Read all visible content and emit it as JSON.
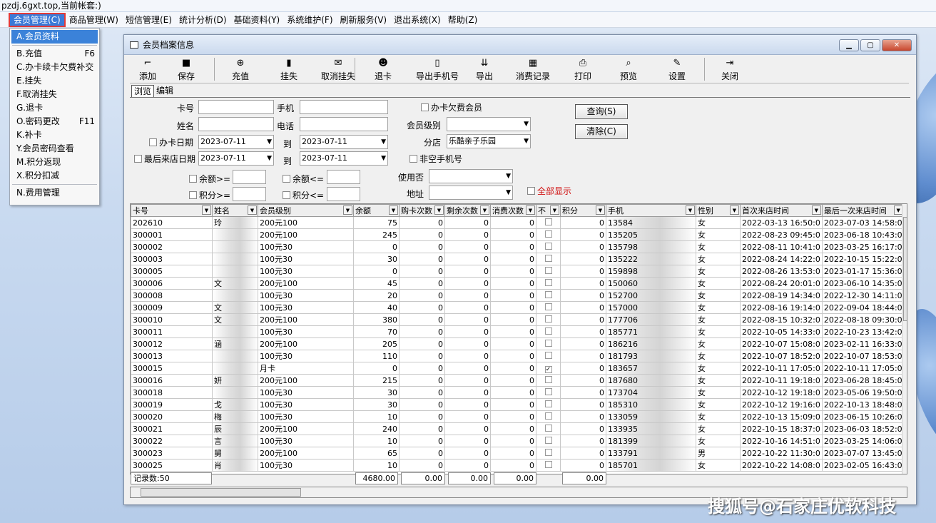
{
  "top_title": "pzdj.6gxt.top,当前帐套:)",
  "menubar": [
    "会员管理(C)",
    "商品管理(W)",
    "短信管理(E)",
    "统计分析(D)",
    "基础资料(Y)",
    "系统维护(F)",
    "刷新服务(V)",
    "退出系统(X)",
    "帮助(Z)"
  ],
  "dropdown": [
    {
      "label": "A.会员资料",
      "key": ""
    },
    {
      "sep": true
    },
    {
      "label": "B.充值",
      "key": "F6"
    },
    {
      "label": "C.办卡续卡欠费补交",
      "key": ""
    },
    {
      "label": "E.挂失",
      "key": ""
    },
    {
      "label": "F.取消挂失",
      "key": ""
    },
    {
      "label": "G.退卡",
      "key": ""
    },
    {
      "label": "O.密码更改",
      "key": "F11"
    },
    {
      "label": "K.补卡",
      "key": ""
    },
    {
      "label": "Y.会员密码查看",
      "key": ""
    },
    {
      "label": "M.积分返现",
      "key": ""
    },
    {
      "label": "X.积分扣减",
      "key": ""
    },
    {
      "sep": true
    },
    {
      "label": "N.费用管理",
      "key": ""
    }
  ],
  "window_title": "会员档案信息",
  "toolbar": [
    {
      "label": "添加",
      "icon": "add-icon"
    },
    {
      "label": "保存",
      "icon": "save-icon"
    },
    {
      "label": "充值",
      "icon": "recharge-icon"
    },
    {
      "label": "挂失",
      "icon": "report-loss-icon"
    },
    {
      "label": "取消挂失",
      "icon": "cancel-loss-icon"
    },
    {
      "label": "退卡",
      "icon": "return-card-icon"
    },
    {
      "label": "导出手机号",
      "icon": "export-phone-icon"
    },
    {
      "label": "导出",
      "icon": "export-icon"
    },
    {
      "label": "消费记录",
      "icon": "consume-record-icon"
    },
    {
      "label": "打印",
      "icon": "print-icon"
    },
    {
      "label": "预览",
      "icon": "preview-icon"
    },
    {
      "label": "设置",
      "icon": "settings-icon"
    },
    {
      "label": "关闭",
      "icon": "close-door-icon"
    }
  ],
  "tabs": [
    "浏览",
    "编辑"
  ],
  "form": {
    "card_no": "卡号",
    "phone": "手机",
    "name": "姓名",
    "tel": "电话",
    "owe": "办卡欠费会员",
    "level": "会员级别",
    "card_date": "办卡日期",
    "date1": "2023-07-11",
    "to": "到",
    "date2": "2023-07-11",
    "branch": "分店",
    "branch_value": "乐酷亲子乐园",
    "last_visit": "最后来店日期",
    "date3": "2023-07-11",
    "date4": "2023-07-11",
    "non_empty_phone": "非空手机号",
    "balance_ge": "余额>=",
    "balance_le": "余额<=",
    "in_use": "使用否",
    "points_ge": "积分>=",
    "points_le": "积分<=",
    "address": "地址",
    "show_all": "全部显示",
    "query": "查询(S)",
    "clear": "清除(C)"
  },
  "columns": [
    "卡号",
    "姓名",
    "会员级别",
    "余额",
    "购卡次数",
    "剩余次数",
    "消费次数",
    "不",
    "积分",
    "手机",
    "性别",
    "首次来店时间",
    "最后一次来店时间"
  ],
  "rows": [
    [
      "202610",
      "玲",
      "200元100",
      "75",
      "0",
      "0",
      "0",
      false,
      "0",
      "13584",
      "女",
      "2022-03-13 16:50:0",
      "2023-07-03 14:58:0"
    ],
    [
      "300001",
      "",
      "200元100",
      "245",
      "0",
      "0",
      "0",
      false,
      "0",
      "135205",
      "女",
      "2022-08-23 09:45:0",
      "2023-06-18 10:43:0"
    ],
    [
      "300002",
      "",
      "100元30",
      "0",
      "0",
      "0",
      "0",
      false,
      "0",
      "135798",
      "女",
      "2022-08-11 10:41:0",
      "2023-03-25 16:17:0"
    ],
    [
      "300003",
      "",
      "100元30",
      "30",
      "0",
      "0",
      "0",
      false,
      "0",
      "135222",
      "女",
      "2022-08-24 14:22:0",
      "2022-10-15 15:22:0"
    ],
    [
      "300005",
      "",
      "100元30",
      "0",
      "0",
      "0",
      "0",
      false,
      "0",
      "159898",
      "女",
      "2022-08-26 13:53:0",
      "2023-01-17 15:36:0"
    ],
    [
      "300006",
      "文",
      "200元100",
      "45",
      "0",
      "0",
      "0",
      false,
      "0",
      "150060",
      "女",
      "2022-08-24 20:01:0",
      "2023-06-10 14:35:0"
    ],
    [
      "300008",
      "",
      "100元30",
      "20",
      "0",
      "0",
      "0",
      false,
      "0",
      "152700",
      "女",
      "2022-08-19 14:34:0",
      "2022-12-30 14:11:0"
    ],
    [
      "300009",
      "文",
      "100元30",
      "40",
      "0",
      "0",
      "0",
      false,
      "0",
      "157000",
      "女",
      "2022-08-16 19:14:0",
      "2022-09-04 18:44:0"
    ],
    [
      "300010",
      "文",
      "200元100",
      "380",
      "0",
      "0",
      "0",
      false,
      "0",
      "177706",
      "女",
      "2022-08-15 10:32:0",
      "2022-08-18 09:30:0"
    ],
    [
      "300011",
      "",
      "100元30",
      "70",
      "0",
      "0",
      "0",
      false,
      "0",
      "185771",
      "女",
      "2022-10-05 14:33:0",
      "2022-10-23 13:42:0"
    ],
    [
      "300012",
      "涵",
      "200元100",
      "205",
      "0",
      "0",
      "0",
      false,
      "0",
      "186216",
      "女",
      "2022-10-07 15:08:0",
      "2023-02-11 16:33:0"
    ],
    [
      "300013",
      "",
      "100元30",
      "110",
      "0",
      "0",
      "0",
      false,
      "0",
      "181793",
      "女",
      "2022-10-07 18:52:0",
      "2022-10-07 18:53:0"
    ],
    [
      "300015",
      "",
      "月卡",
      "0",
      "0",
      "0",
      "0",
      true,
      "0",
      "183657",
      "女",
      "2022-10-11 17:05:0",
      "2022-10-11 17:05:0"
    ],
    [
      "300016",
      "妍",
      "200元100",
      "215",
      "0",
      "0",
      "0",
      false,
      "0",
      "187680",
      "女",
      "2022-10-11 19:18:0",
      "2023-06-28 18:45:0"
    ],
    [
      "300018",
      "",
      "100元30",
      "30",
      "0",
      "0",
      "0",
      false,
      "0",
      "173704",
      "女",
      "2022-10-12 19:18:0",
      "2023-05-06 19:50:0"
    ],
    [
      "300019",
      "戈",
      "100元30",
      "30",
      "0",
      "0",
      "0",
      false,
      "0",
      "185310",
      "女",
      "2022-10-12 19:16:0",
      "2022-10-13 18:48:0"
    ],
    [
      "300020",
      "梅",
      "100元30",
      "10",
      "0",
      "0",
      "0",
      false,
      "0",
      "133059",
      "女",
      "2022-10-13 15:09:0",
      "2023-06-15 10:26:0"
    ],
    [
      "300021",
      "辰",
      "200元100",
      "240",
      "0",
      "0",
      "0",
      false,
      "0",
      "133935",
      "女",
      "2022-10-15 18:37:0",
      "2023-06-03 18:52:0"
    ],
    [
      "300022",
      "言",
      "100元30",
      "10",
      "0",
      "0",
      "0",
      false,
      "0",
      "181399",
      "女",
      "2022-10-16 14:51:0",
      "2023-03-25 14:06:0"
    ],
    [
      "300023",
      "舅",
      "200元100",
      "65",
      "0",
      "0",
      "0",
      false,
      "0",
      "133791",
      "男",
      "2022-10-22 11:30:0",
      "2023-07-07 13:45:0"
    ],
    [
      "300025",
      "肖",
      "100元30",
      "10",
      "0",
      "0",
      "0",
      false,
      "0",
      "185701",
      "女",
      "2022-10-22 14:08:0",
      "2023-02-05 16:43:0"
    ]
  ],
  "footer": {
    "count": "记录数:50",
    "balance": "4680.00",
    "c1": "0.00",
    "c2": "0.00",
    "c3": "0.00",
    "points": "0.00"
  },
  "watermark": "搜狐号@石家庄优软科技"
}
